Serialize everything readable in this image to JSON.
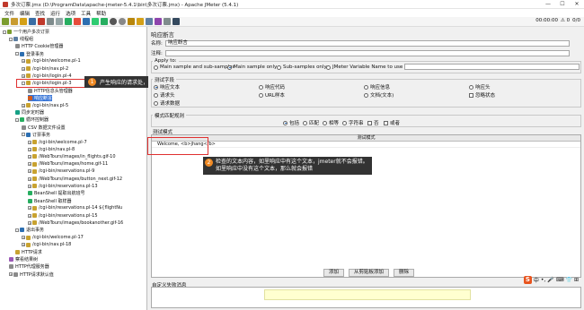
{
  "window": {
    "title": "多次订票.jmx (D:\\ProgramData\\apache-jmeter-5.4.1\\bin\\多次订票.jmx) - Apache JMeter (5.4.1)",
    "minimize": "—",
    "maximize": "☐",
    "close": "✕"
  },
  "menu": [
    "文件",
    "编辑",
    "查找",
    "运行",
    "选项",
    "工具",
    "帮助"
  ],
  "toolbar_right": {
    "time": "00:00:00",
    "warn": "⚠ 0",
    "counter": "0/0"
  },
  "tree": [
    {
      "label": "一个用户多次订票",
      "icon": "plan",
      "indent": 0,
      "toggle": "-"
    },
    {
      "label": "线程组",
      "icon": "group",
      "indent": 1,
      "toggle": "-"
    },
    {
      "label": "HTTP Cookie管理器",
      "icon": "cfg",
      "indent": 2,
      "toggle": ""
    },
    {
      "label": "登录事务",
      "icon": "txn",
      "indent": 2,
      "toggle": "-"
    },
    {
      "label": "/cgi-bin/welcome.pl-1",
      "icon": "smp",
      "indent": 3,
      "toggle": "+"
    },
    {
      "label": "/cgi-bin/nav.pl-2",
      "icon": "smp",
      "indent": 3,
      "toggle": "+"
    },
    {
      "label": "/cgi-bin/login.pl-4",
      "icon": "smp",
      "indent": 3,
      "toggle": "+"
    },
    {
      "label": "/cgi-bin/login.pl-3",
      "icon": "smp",
      "indent": 3,
      "toggle": "-"
    },
    {
      "label": "HTTP信息头管理器",
      "icon": "cfg",
      "indent": 4,
      "toggle": ""
    },
    {
      "label": "响应断言",
      "icon": "ast",
      "indent": 4,
      "toggle": "",
      "selected": true
    },
    {
      "label": "/cgi-bin/nav.pl-5",
      "icon": "smp",
      "indent": 3,
      "toggle": "+"
    },
    {
      "label": "同步定时器",
      "icon": "tmr",
      "indent": 2,
      "toggle": ""
    },
    {
      "label": "循环控制器",
      "icon": "ctl",
      "indent": 2,
      "toggle": "-"
    },
    {
      "label": "CSV 数据文件设置",
      "icon": "cfg",
      "indent": 3,
      "toggle": ""
    },
    {
      "label": "订票事务",
      "icon": "txn",
      "indent": 3,
      "toggle": "-"
    },
    {
      "label": "/cgi-bin/welcome.pl-7",
      "icon": "smp",
      "indent": 4,
      "toggle": "+"
    },
    {
      "label": "/cgi-bin/nav.pl-8",
      "icon": "smp",
      "indent": 4,
      "toggle": "+"
    },
    {
      "label": "/WebTours/images/in_flights.gif-10",
      "icon": "smp",
      "indent": 4,
      "toggle": "+"
    },
    {
      "label": "/WebTours/images/home.gif-11",
      "icon": "smp",
      "indent": 4,
      "toggle": "+"
    },
    {
      "label": "/cgi-bin/reservations.pl-9",
      "icon": "smp",
      "indent": 4,
      "toggle": "+"
    },
    {
      "label": "/WebTours/images/button_next.gif-12",
      "icon": "smp",
      "indent": 4,
      "toggle": "+"
    },
    {
      "label": "/cgi-bin/reservations.pl-13",
      "icon": "smp",
      "indent": 4,
      "toggle": "+"
    },
    {
      "label": "BeanShell 提取出航班号",
      "icon": "ctl",
      "indent": 4,
      "toggle": ""
    },
    {
      "label": "BeanShell 取样器",
      "icon": "ctl",
      "indent": 4,
      "toggle": ""
    },
    {
      "label": "/cgi-bin/reservations.pl-14 ${flightNu",
      "icon": "smp",
      "indent": 4,
      "toggle": "+"
    },
    {
      "label": "/cgi-bin/reservations.pl-15",
      "icon": "smp",
      "indent": 4,
      "toggle": "+"
    },
    {
      "label": "/WebTours/images/bookanother.gif-16",
      "icon": "smp",
      "indent": 4,
      "toggle": "+"
    },
    {
      "label": "退出事务",
      "icon": "txn",
      "indent": 2,
      "toggle": "-"
    },
    {
      "label": "/cgi-bin/welcome.pl-17",
      "icon": "smp",
      "indent": 3,
      "toggle": "+"
    },
    {
      "label": "/cgi-bin/nav.pl-18",
      "icon": "smp",
      "indent": 3,
      "toggle": "+"
    },
    {
      "label": "HTTP请求",
      "icon": "smp",
      "indent": 2,
      "toggle": ""
    },
    {
      "label": "察看结果树",
      "icon": "lst",
      "indent": 1,
      "toggle": ""
    },
    {
      "label": "HTTP代理服务器",
      "icon": "cfg",
      "indent": 1,
      "toggle": ""
    },
    {
      "label": "HTTP请求默认值",
      "icon": "cfg",
      "indent": 1,
      "toggle": "+"
    }
  ],
  "callout1": {
    "num": "1",
    "text": "产生响应的请求处，右击添加响应断言"
  },
  "callout2": {
    "num": "2",
    "line1": "检查的文本内容，如里响应中有这个文本，jmeter就不会报错。",
    "line2": "如里响应中没有这个文本，那么就会报错"
  },
  "panel": {
    "title": "响应断言",
    "name_label": "名称:",
    "name_value": "响应断言",
    "comment_label": "注释:",
    "comment_value": "",
    "apply_to_label": "Apply to:",
    "apply_options": [
      "Main sample and sub-samples",
      "Main sample only",
      "Sub-samples only",
      "JMeter Variable Name to use"
    ],
    "test_field_label": "测试字段",
    "test_fields": [
      "响应文本",
      "响应代码",
      "响应信息",
      "响应头",
      "请求头",
      "URL样本",
      "文档(文本)",
      "忽略状态",
      "请求数据"
    ],
    "pattern_rule_label": "模式匹配规则",
    "pattern_rules": [
      "包括",
      "匹配",
      "相等",
      "字符串",
      "否",
      "或者"
    ],
    "test_patterns_label": "测试模式",
    "patterns_header": "测试模式",
    "patterns": [
      "Welcome, <b>jhang</b>"
    ],
    "buttons": [
      "添加",
      "从剪贴板添加",
      "删除"
    ],
    "custom_failure_label": "自定义失败消息"
  },
  "ime": {
    "logo": "S",
    "lang": "中",
    "punct": "•,",
    "mic": "🎤",
    "kbd": "⌨",
    "skin": "👕",
    "grid": "⊞"
  }
}
